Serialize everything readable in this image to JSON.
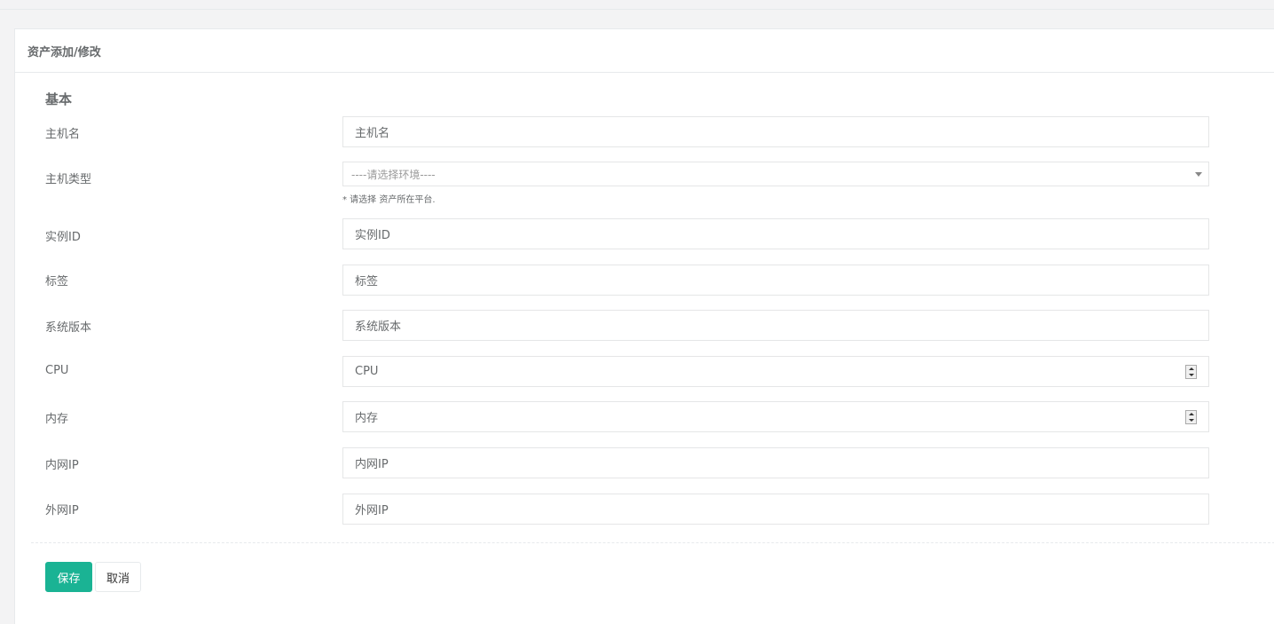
{
  "panel": {
    "title": "资产添加/修改"
  },
  "section": {
    "title": "基本"
  },
  "fields": {
    "hostname": {
      "label": "主机名",
      "placeholder": "主机名"
    },
    "host_type": {
      "label": "主机类型",
      "selected": "----请选择环境----",
      "help": "* 请选择 资产所在平台."
    },
    "instance_id": {
      "label": "实例ID",
      "placeholder": "实例ID"
    },
    "tags": {
      "label": "标签",
      "placeholder": "标签"
    },
    "os_version": {
      "label": "系统版本",
      "placeholder": "系统版本"
    },
    "cpu": {
      "label": "CPU",
      "placeholder": "CPU"
    },
    "memory": {
      "label": "内存",
      "placeholder": "内存"
    },
    "private_ip": {
      "label": "内网IP",
      "placeholder": "内网IP"
    },
    "public_ip": {
      "label": "外网IP",
      "placeholder": "外网IP"
    }
  },
  "buttons": {
    "save": "保存",
    "cancel": "取消"
  },
  "colors": {
    "primary": "#1ab394",
    "text": "#676a6c",
    "border": "#e5e6e7"
  }
}
